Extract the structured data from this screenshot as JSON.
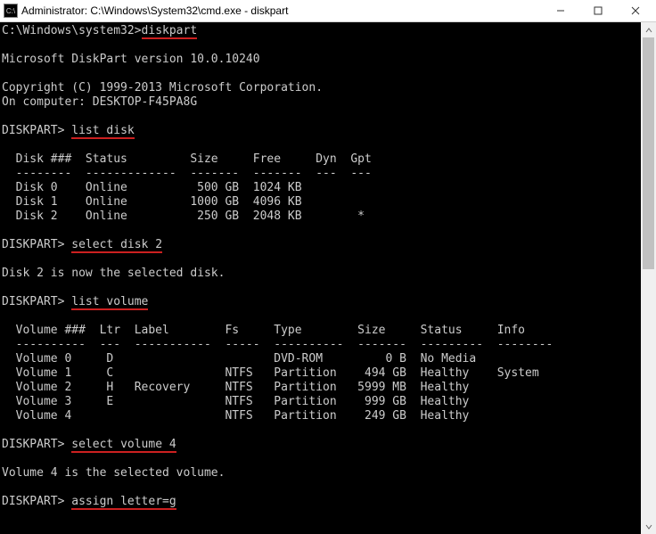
{
  "titlebar": {
    "title": "Administrator: C:\\Windows\\System32\\cmd.exe - diskpart"
  },
  "terminal": {
    "prompt_path": "C:\\Windows\\system32>",
    "cmd_diskpart": "diskpart",
    "blank": "",
    "version_line": "Microsoft DiskPart version 10.0.10240",
    "copyright_line": "Copyright (C) 1999-2013 Microsoft Corporation.",
    "on_computer_line": "On computer: DESKTOP-F45PA8G",
    "dp_prompt": "DISKPART> ",
    "cmd_list_disk": "list disk",
    "disk_header": "  Disk ###  Status         Size     Free     Dyn  Gpt",
    "disk_divider": "  --------  -------------  -------  -------  ---  ---",
    "disk_rows": [
      "  Disk 0    Online          500 GB  1024 KB",
      "  Disk 1    Online         1000 GB  4096 KB",
      "  Disk 2    Online          250 GB  2048 KB        *"
    ],
    "cmd_select_disk": "select disk 2",
    "disk_selected_msg": "Disk 2 is now the selected disk.",
    "cmd_list_volume": "list volume",
    "vol_header": "  Volume ###  Ltr  Label        Fs     Type        Size     Status     Info",
    "vol_divider": "  ----------  ---  -----------  -----  ----------  -------  ---------  --------",
    "vol_rows": [
      "  Volume 0     D                       DVD-ROM         0 B  No Media",
      "  Volume 1     C                NTFS   Partition    494 GB  Healthy    System",
      "  Volume 2     H   Recovery     NTFS   Partition   5999 MB  Healthy",
      "  Volume 3     E                NTFS   Partition    999 GB  Healthy",
      "  Volume 4                      NTFS   Partition    249 GB  Healthy"
    ],
    "cmd_select_volume": "select volume 4",
    "vol_selected_msg": "Volume 4 is the selected volume.",
    "cmd_assign_letter": "assign letter=g"
  }
}
